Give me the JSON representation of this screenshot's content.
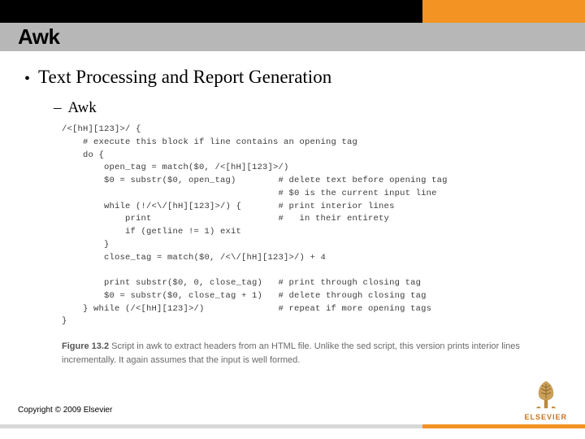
{
  "title": "Awk",
  "bullets": {
    "level1": "Text Processing and Report Generation",
    "level2": "Awk"
  },
  "code_lines": [
    "/<[hH][123]>/ {",
    "    # execute this block if line contains an opening tag",
    "    do {",
    "        open_tag = match($0, /<[hH][123]>/)",
    "        $0 = substr($0, open_tag)        # delete text before opening tag",
    "                                         # $0 is the current input line",
    "        while (!/<\\/[hH][123]>/) {       # print interior lines",
    "            print                        #   in their entirety",
    "            if (getline != 1) exit",
    "        }",
    "        close_tag = match($0, /<\\/[hH][123]>/) + 4",
    "",
    "        print substr($0, 0, close_tag)   # print through closing tag",
    "        $0 = substr($0, close_tag + 1)   # delete through closing tag",
    "    } while (/<[hH][123]>/)              # repeat if more opening tags",
    "}"
  ],
  "caption": {
    "fignum": "Figure 13.2",
    "text": " Script in awk to extract headers from an HTML file. Unlike the sed script, this version prints interior lines incrementally. It again assumes that the input is well formed."
  },
  "copyright": "Copyright © 2009 Elsevier",
  "logo_text": "ELSEVIER"
}
